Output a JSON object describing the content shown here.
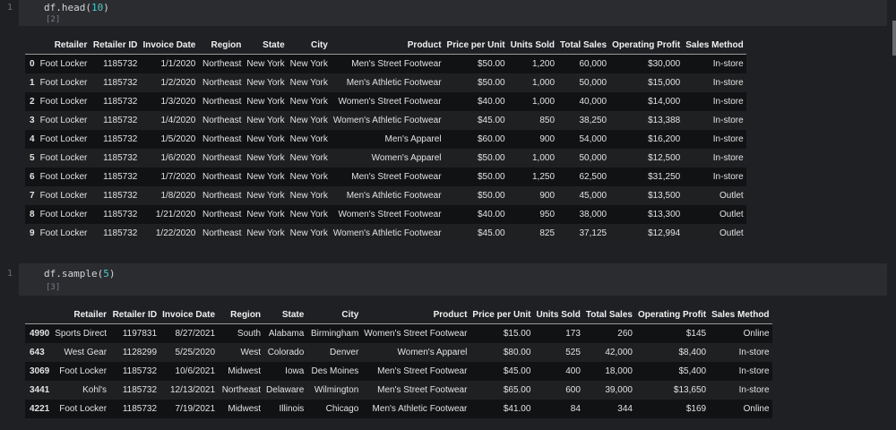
{
  "cells": [
    {
      "line_number": "1",
      "code_fn": "df.head(",
      "code_arg": "10",
      "code_close": ")",
      "exec_count": "[2]",
      "columns": [
        "",
        "Retailer",
        "Retailer ID",
        "Invoice Date",
        "Region",
        "State",
        "City",
        "Product",
        "Price per Unit",
        "Units Sold",
        "Total Sales",
        "Operating Profit",
        "Sales Method"
      ],
      "rows": [
        [
          "0",
          "Foot Locker",
          "1185732",
          "1/1/2020",
          "Northeast",
          "New York",
          "New York",
          "Men's Street Footwear",
          "$50.00",
          "1,200",
          "60,000",
          "$30,000",
          "In-store"
        ],
        [
          "1",
          "Foot Locker",
          "1185732",
          "1/2/2020",
          "Northeast",
          "New York",
          "New York",
          "Men's Athletic Footwear",
          "$50.00",
          "1,000",
          "50,000",
          "$15,000",
          "In-store"
        ],
        [
          "2",
          "Foot Locker",
          "1185732",
          "1/3/2020",
          "Northeast",
          "New York",
          "New York",
          "Women's Street Footwear",
          "$40.00",
          "1,000",
          "40,000",
          "$14,000",
          "In-store"
        ],
        [
          "3",
          "Foot Locker",
          "1185732",
          "1/4/2020",
          "Northeast",
          "New York",
          "New York",
          "Women's Athletic Footwear",
          "$45.00",
          "850",
          "38,250",
          "$13,388",
          "In-store"
        ],
        [
          "4",
          "Foot Locker",
          "1185732",
          "1/5/2020",
          "Northeast",
          "New York",
          "New York",
          "Men's Apparel",
          "$60.00",
          "900",
          "54,000",
          "$16,200",
          "In-store"
        ],
        [
          "5",
          "Foot Locker",
          "1185732",
          "1/6/2020",
          "Northeast",
          "New York",
          "New York",
          "Women's Apparel",
          "$50.00",
          "1,000",
          "50,000",
          "$12,500",
          "In-store"
        ],
        [
          "6",
          "Foot Locker",
          "1185732",
          "1/7/2020",
          "Northeast",
          "New York",
          "New York",
          "Men's Street Footwear",
          "$50.00",
          "1,250",
          "62,500",
          "$31,250",
          "In-store"
        ],
        [
          "7",
          "Foot Locker",
          "1185732",
          "1/8/2020",
          "Northeast",
          "New York",
          "New York",
          "Men's Athletic Footwear",
          "$50.00",
          "900",
          "45,000",
          "$13,500",
          "Outlet"
        ],
        [
          "8",
          "Foot Locker",
          "1185732",
          "1/21/2020",
          "Northeast",
          "New York",
          "New York",
          "Women's Street Footwear",
          "$40.00",
          "950",
          "38,000",
          "$13,300",
          "Outlet"
        ],
        [
          "9",
          "Foot Locker",
          "1185732",
          "1/22/2020",
          "Northeast",
          "New York",
          "New York",
          "Women's Athletic Footwear",
          "$45.00",
          "825",
          "37,125",
          "$12,994",
          "Outlet"
        ]
      ]
    },
    {
      "line_number": "1",
      "code_fn": "df.sample(",
      "code_arg": "5",
      "code_close": ")",
      "exec_count": "[3]",
      "columns": [
        "",
        "Retailer",
        "Retailer ID",
        "Invoice Date",
        "Region",
        "State",
        "City",
        "Product",
        "Price per Unit",
        "Units Sold",
        "Total Sales",
        "Operating Profit",
        "Sales Method"
      ],
      "rows": [
        [
          "4990",
          "Sports Direct",
          "1197831",
          "8/27/2021",
          "South",
          "Alabama",
          "Birmingham",
          "Women's Street Footwear",
          "$15.00",
          "173",
          "260",
          "$145",
          "Online"
        ],
        [
          "643",
          "West Gear",
          "1128299",
          "5/25/2020",
          "West",
          "Colorado",
          "Denver",
          "Women's Apparel",
          "$80.00",
          "525",
          "42,000",
          "$8,400",
          "In-store"
        ],
        [
          "3069",
          "Foot Locker",
          "1185732",
          "10/6/2021",
          "Midwest",
          "Iowa",
          "Des Moines",
          "Men's Street Footwear",
          "$45.00",
          "400",
          "18,000",
          "$5,400",
          "In-store"
        ],
        [
          "3441",
          "Kohl's",
          "1185732",
          "12/13/2021",
          "Northeast",
          "Delaware",
          "Wilmington",
          "Men's Street Footwear",
          "$65.00",
          "600",
          "39,000",
          "$13,650",
          "In-store"
        ],
        [
          "4221",
          "Foot Locker",
          "1185732",
          "7/19/2021",
          "Midwest",
          "Illinois",
          "Chicago",
          "Men's Athletic Footwear",
          "$41.00",
          "84",
          "344",
          "$169",
          "Online"
        ]
      ]
    }
  ]
}
